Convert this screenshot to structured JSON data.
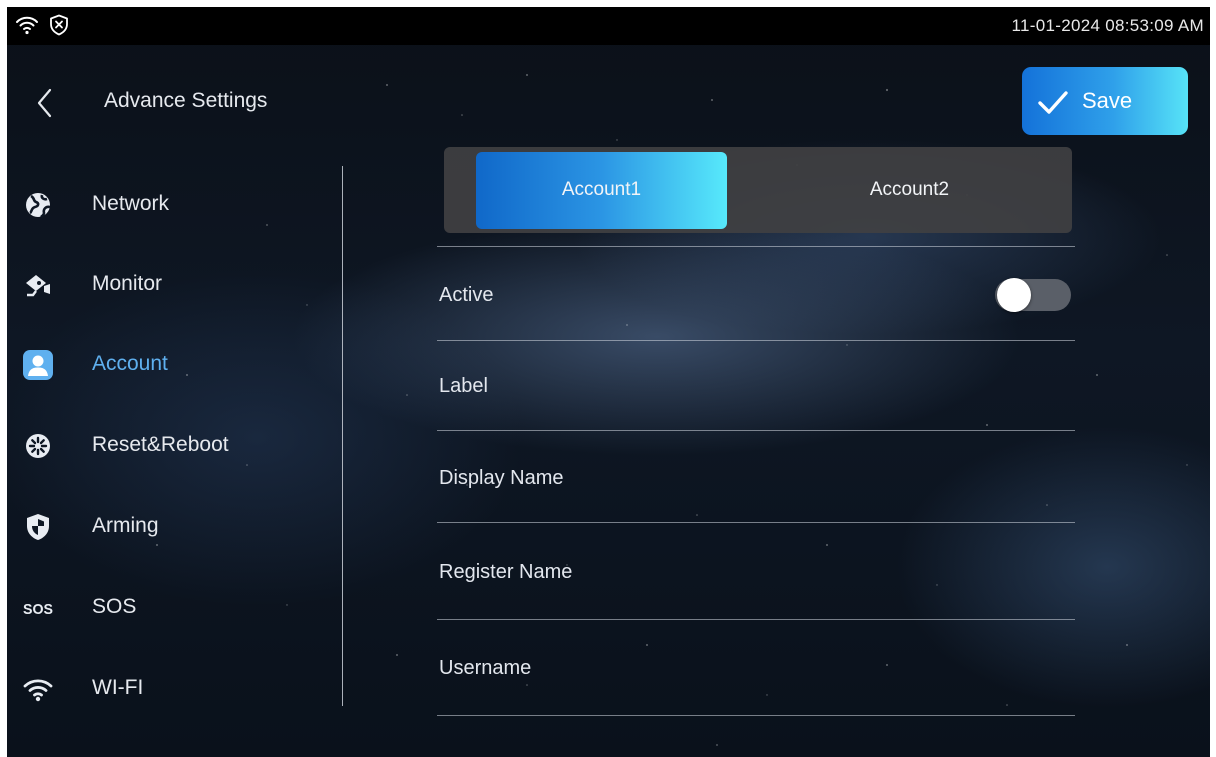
{
  "status_bar": {
    "wifi_icon": "wifi-icon",
    "security_icon": "shield-x-icon",
    "datetime": "11-01-2024 08:53:09 AM"
  },
  "header": {
    "back_icon": "chevron-left-icon",
    "title": "Advance Settings",
    "save": {
      "label": "Save",
      "icon": "checkmark-icon"
    }
  },
  "sidebar": {
    "items": [
      {
        "label": "Network",
        "icon": "globe-icon",
        "active": false
      },
      {
        "label": "Monitor",
        "icon": "camera-icon",
        "active": false
      },
      {
        "label": "Account",
        "icon": "user-icon",
        "active": true
      },
      {
        "label": "Reset&Reboot",
        "icon": "reset-icon",
        "active": false
      },
      {
        "label": "Arming",
        "icon": "shield-icon",
        "active": false
      },
      {
        "label": "SOS",
        "icon": "sos-icon",
        "active": false
      },
      {
        "label": "WI-FI",
        "icon": "wifi-icon",
        "active": false
      }
    ]
  },
  "tabs": [
    {
      "label": "Account1",
      "active": true
    },
    {
      "label": "Account2",
      "active": false
    }
  ],
  "fields": [
    {
      "label": "Active",
      "type": "toggle",
      "value": false
    },
    {
      "label": "Label",
      "value": ""
    },
    {
      "label": "Display Name",
      "value": ""
    },
    {
      "label": "Register Name",
      "value": ""
    },
    {
      "label": "Username",
      "value": ""
    }
  ],
  "colors": {
    "accent": "#5fb0ef",
    "gradient_start": "#1068c9",
    "gradient_end": "#57e9fb",
    "background": "#0e1724"
  }
}
